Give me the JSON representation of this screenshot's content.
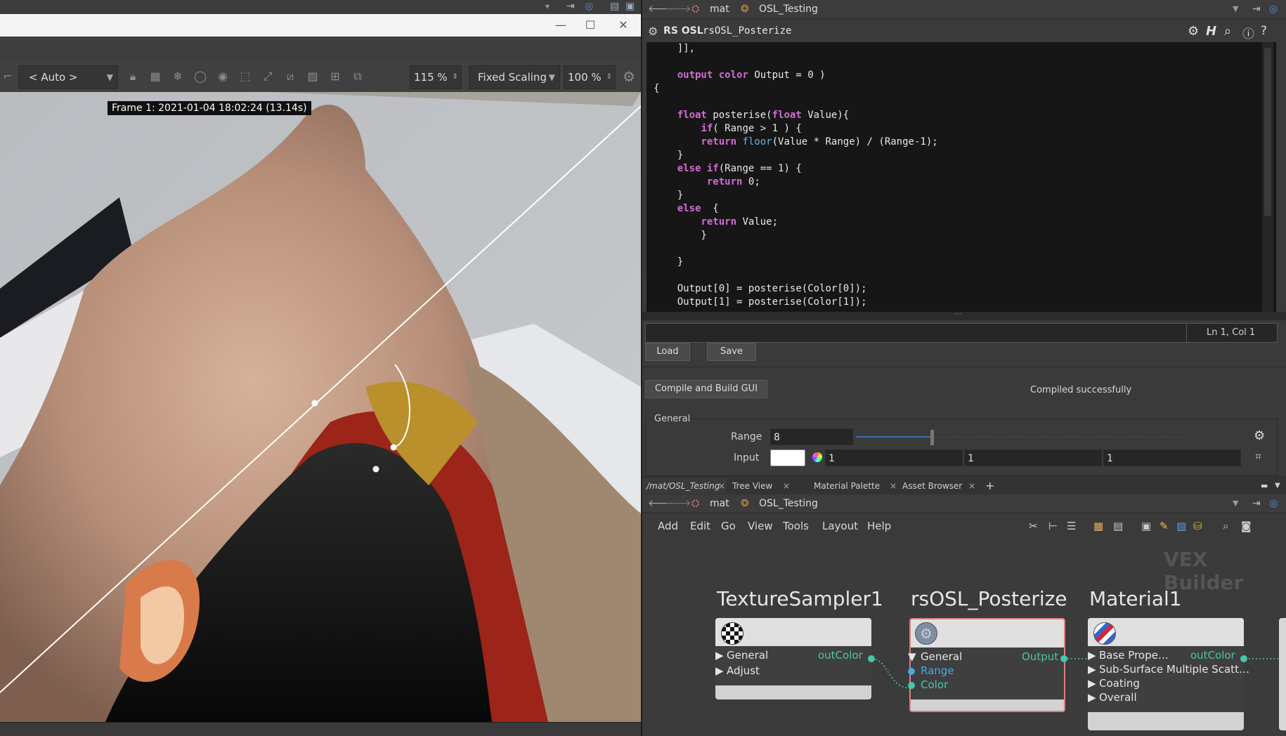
{
  "render_view": {
    "auto_dropdown": "< Auto >",
    "zoom": "115 %",
    "scaling_mode": "Fixed Scaling",
    "scale": "100 %",
    "frame_label": "Frame 1: 2021-01-04 18:02:24 (13.14s)"
  },
  "path_bar_top": {
    "items": [
      "mat",
      "OSL_Testing"
    ]
  },
  "osl_panel": {
    "type_label": "RS OSL",
    "node_name": "rsOSL_Posterize",
    "cursor_position": "Ln 1, Col 1",
    "load_label": "Load",
    "save_label": "Save",
    "compile_label": "Compile and Build GUI",
    "compile_status": "Compiled successfully",
    "code_lines": [
      "    ]],",
      "",
      "    output color Output = 0 )",
      "{",
      "",
      "    float posterise(float Value){",
      "        if( Range > 1 ) {",
      "        return floor(Value * Range) / (Range-1);",
      "    }",
      "    else if(Range == 1) {",
      "         return 0;",
      "    }",
      "    else  {",
      "        return Value;",
      "        }",
      "",
      "    }",
      "",
      "    Output[0] = posterise(Color[0]);",
      "    Output[1] = posterise(Color[1]);"
    ]
  },
  "parameters": {
    "folder_label": "General",
    "range_label": "Range",
    "range_value": "8",
    "range_fraction": 0.23,
    "input_label": "Input",
    "input_values": [
      "1",
      "1",
      "1"
    ]
  },
  "tabs": [
    {
      "label": "/mat/OSL_Testing"
    },
    {
      "label": "Tree View"
    },
    {
      "label": "Material Palette"
    },
    {
      "label": "Asset Browser"
    }
  ],
  "path_bar_bottom": {
    "items": [
      "mat",
      "OSL_Testing"
    ]
  },
  "menu": [
    "Add",
    "Edit",
    "Go",
    "View",
    "Tools",
    "Layout",
    "Help"
  ],
  "network": {
    "context_label": "VEX Builder",
    "nodes": [
      {
        "title": "TextureSampler1",
        "inputs": [
          "General",
          "Adjust"
        ],
        "output": "outColor"
      },
      {
        "title": "rsOSL_Posterize",
        "inputs": [
          "General",
          "Range",
          "Color"
        ],
        "output": "Output"
      },
      {
        "title": "Material1",
        "inputs": [
          "Base Prope…",
          "Sub-Surface Multiple Scatt…",
          "Coating",
          "Overall"
        ],
        "output": "outColor"
      }
    ]
  },
  "colors": {
    "accent_port": "#45c7a8",
    "range_port": "#4aa8e0",
    "keyword": "#d36cd3"
  }
}
